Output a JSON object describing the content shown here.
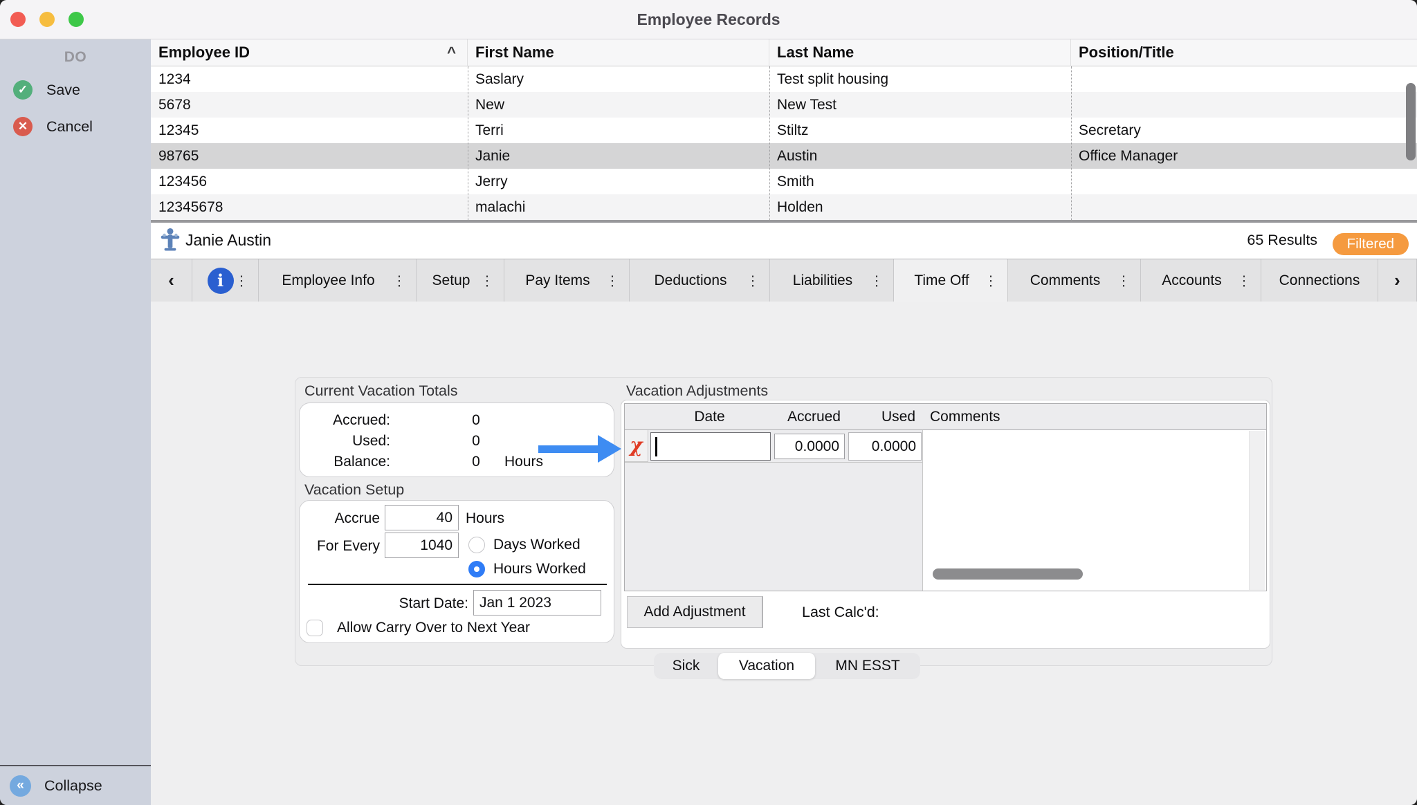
{
  "colors": {
    "badge": "#F59A3F",
    "arrow": "#3E8CF2",
    "info": "#2A5FD0",
    "radio": "#2F7CF6",
    "save": "#53AF7B",
    "cancel": "#D95B4E",
    "collapse": "#74A9DF",
    "del": "#E03B24"
  },
  "window": {
    "title": "Employee Records"
  },
  "sidebar": {
    "header": "DO",
    "save_label": "Save",
    "cancel_label": "Cancel",
    "collapse_label": "Collapse",
    "save_icon": "✓",
    "cancel_icon": "✕",
    "collapse_icon": "«"
  },
  "employee_table": {
    "columns": [
      "Employee ID",
      "First Name",
      "Last Name",
      "Position/Title"
    ],
    "sort_column_index": 0,
    "sort_indicator": "^",
    "selected_row_index": 3,
    "rows": [
      [
        "1234",
        "Saslary",
        "Test split housing",
        ""
      ],
      [
        "5678",
        "New",
        "New Test",
        ""
      ],
      [
        "12345",
        "Terri",
        "Stiltz",
        "Secretary"
      ],
      [
        "98765",
        "Janie",
        "Austin",
        "Office Manager"
      ],
      [
        "123456",
        "Jerry",
        "Smith",
        ""
      ],
      [
        "12345678",
        "malachi",
        "Holden",
        ""
      ]
    ]
  },
  "record_header": {
    "name": "Janie Austin",
    "results": "65 Results",
    "filter_badge": "Filtered"
  },
  "tab_bar": {
    "back_chevron": "‹",
    "forward_chevron": "›",
    "info_glyph": "i",
    "menu_glyph": "⋮",
    "tabs": [
      {
        "label": "Employee Info",
        "selected": false,
        "menu": true
      },
      {
        "label": "Setup",
        "selected": false,
        "menu": true
      },
      {
        "label": "Pay Items",
        "selected": false,
        "menu": true
      },
      {
        "label": "Deductions",
        "selected": false,
        "menu": true
      },
      {
        "label": "Liabilities",
        "selected": false,
        "menu": true
      },
      {
        "label": "Time Off",
        "selected": true,
        "menu": true
      },
      {
        "label": "Comments",
        "selected": false,
        "menu": true
      },
      {
        "label": "Accounts",
        "selected": false,
        "menu": true
      },
      {
        "label": "Connections",
        "selected": false,
        "menu": false
      }
    ]
  },
  "time_off": {
    "totals": {
      "title": "Current Vacation Totals",
      "rows": [
        {
          "label": "Accrued:",
          "value": "0",
          "unit": ""
        },
        {
          "label": "Used:",
          "value": "0",
          "unit": ""
        },
        {
          "label": "Balance:",
          "value": "0",
          "unit": "Hours"
        }
      ]
    },
    "setup": {
      "title": "Vacation Setup",
      "accrue_label": "Accrue",
      "accrue_value": "40",
      "accrue_unit": "Hours",
      "for_every_label": "For Every",
      "for_every_value": "1040",
      "radio_options": [
        {
          "label": "Days Worked",
          "selected": false
        },
        {
          "label": "Hours Worked",
          "selected": true
        }
      ],
      "start_date_label": "Start Date:",
      "start_date_value": "Jan 1 2023",
      "carry_over_label": "Allow Carry Over to Next Year",
      "carry_over_checked": false
    },
    "adjustments": {
      "title": "Vacation Adjustments",
      "columns": [
        "Date",
        "Accrued",
        "Used",
        "Comments"
      ],
      "row": {
        "date": "",
        "accrued": "0.0000",
        "used": "0.0000",
        "comments": ""
      },
      "delete_glyph": "χ",
      "add_button_label": "Add Adjustment",
      "last_calcd_label": "Last Calc'd:"
    },
    "bottom_tabs": [
      {
        "label": "Sick",
        "selected": false
      },
      {
        "label": "Vacation",
        "selected": true
      },
      {
        "label": "MN ESST",
        "selected": false
      }
    ]
  }
}
